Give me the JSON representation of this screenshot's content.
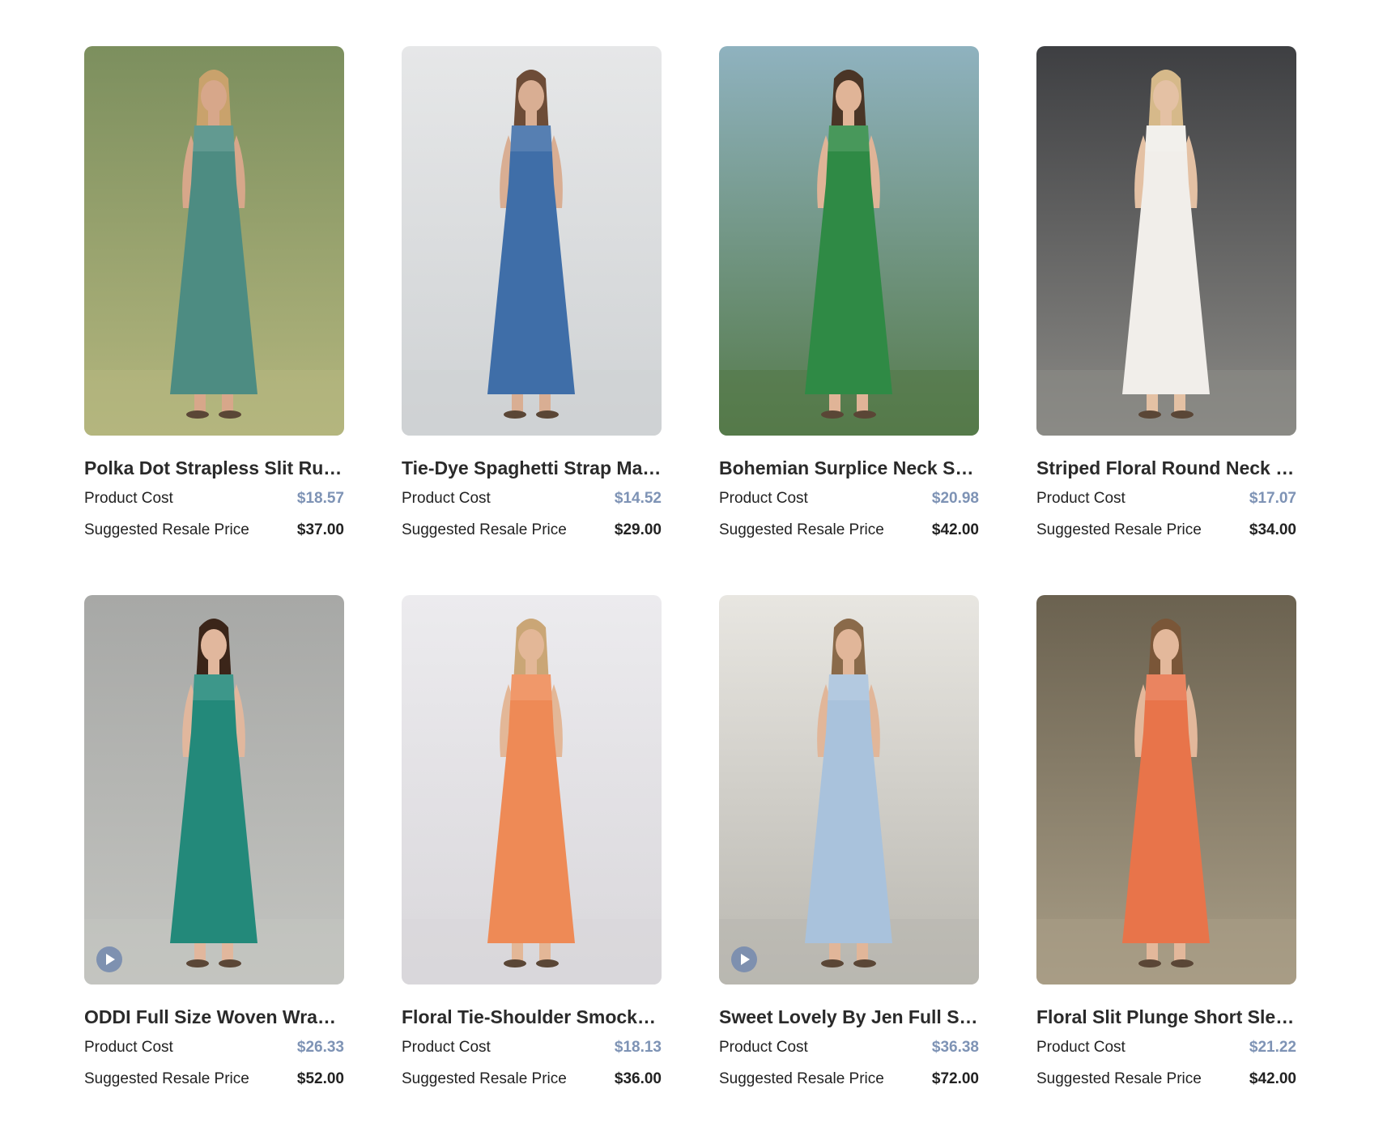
{
  "labels": {
    "product_cost": "Product Cost",
    "suggested_resale": "Suggested Resale Price"
  },
  "products": [
    {
      "title": "Polka Dot Strapless Slit Ruffle Maxi Dress",
      "cost": "$18.57",
      "resale": "$37.00",
      "has_video": false,
      "image": {
        "bg": "#7c8f5e",
        "bg2": "#b4b67e",
        "dress": "#4d8c82",
        "skin": "#d7a78a",
        "hair": "#c9a26c"
      }
    },
    {
      "title": "Tie-Dye Spaghetti Strap Maxi Dress",
      "cost": "$14.52",
      "resale": "$29.00",
      "has_video": false,
      "image": {
        "bg": "#e6e7e8",
        "bg2": "#cfd2d4",
        "dress": "#3f6ea8",
        "skin": "#d9ae93",
        "hair": "#6d4c37"
      }
    },
    {
      "title": "Bohemian Surplice Neck Split Maxi Dress",
      "cost": "$20.98",
      "resale": "$42.00",
      "has_video": false,
      "image": {
        "bg": "#8fb2bf",
        "bg2": "#557a4a",
        "dress": "#2f8a45",
        "skin": "#e0b497",
        "hair": "#4a3526"
      }
    },
    {
      "title": "Striped Floral Round Neck Maxi Dress",
      "cost": "$17.07",
      "resale": "$34.00",
      "has_video": false,
      "image": {
        "bg": "#3e3f42",
        "bg2": "#8b8a86",
        "dress": "#f1eeea",
        "skin": "#e4c1a4",
        "hair": "#d6b98a"
      }
    },
    {
      "title": "ODDI Full Size Woven Wrap Maxi Dress",
      "cost": "$26.33",
      "resale": "$52.00",
      "has_video": true,
      "image": {
        "bg": "#a7a8a6",
        "bg2": "#c3c4c0",
        "dress": "#23897a",
        "skin": "#e1b79d",
        "hair": "#3b2519"
      }
    },
    {
      "title": "Floral Tie-Shoulder Smocked Maxi Dress",
      "cost": "$18.13",
      "resale": "$36.00",
      "has_video": false,
      "image": {
        "bg": "#ecebee",
        "bg2": "#d9d7db",
        "dress": "#ee8a56",
        "skin": "#e3b797",
        "hair": "#caa676"
      }
    },
    {
      "title": "Sweet Lovely By Jen Full Size Maxi Dress",
      "cost": "$36.38",
      "resale": "$72.00",
      "has_video": true,
      "image": {
        "bg": "#e8e6e1",
        "bg2": "#b9b7b0",
        "dress": "#a9c2dc",
        "skin": "#e1b699",
        "hair": "#8a6a4a"
      }
    },
    {
      "title": "Floral Slit Plunge Short Sleeve Maxi Dress",
      "cost": "$21.22",
      "resale": "$42.00",
      "has_video": false,
      "image": {
        "bg": "#6b6250",
        "bg2": "#a89d86",
        "dress": "#e8744a",
        "skin": "#e3b89b",
        "hair": "#7a5638"
      }
    }
  ]
}
